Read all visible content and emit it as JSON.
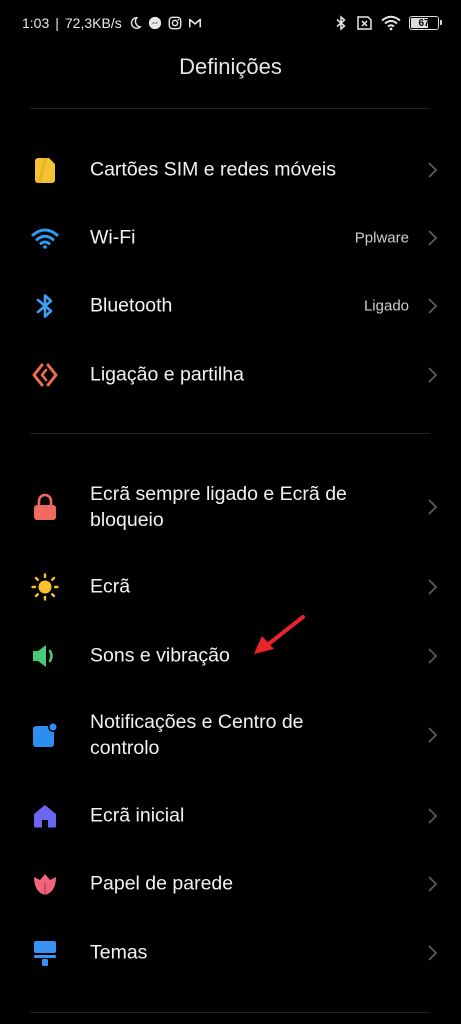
{
  "status_bar": {
    "time": "1:03",
    "separator": "|",
    "speed": "72,3KB/s",
    "battery_level": "67",
    "left_icons": [
      "moon-icon",
      "messenger-icon",
      "instagram-icon",
      "gmail-icon"
    ],
    "right_icons": [
      "bluetooth-icon",
      "no-sim-icon",
      "wifi-icon",
      "battery-icon"
    ]
  },
  "page": {
    "title": "Definições"
  },
  "settings": {
    "sim": {
      "label": "Cartões SIM e redes móveis",
      "icon": "sim-card-icon",
      "color": "#f5c232"
    },
    "wifi": {
      "label": "Wi-Fi",
      "value": "Pplware",
      "icon": "wifi-icon",
      "color": "#2e9cf3"
    },
    "bluetooth": {
      "label": "Bluetooth",
      "value": "Ligado",
      "icon": "bluetooth-icon",
      "color": "#3ea0f5"
    },
    "connection": {
      "label": "Ligação e partilha",
      "icon": "connection-sharing-icon",
      "color": "#f26c4f"
    },
    "lockscreen": {
      "label_line1": "Ecrã sempre ligado e Ecrã de",
      "label_line2": "bloqueio",
      "icon": "lock-icon",
      "color": "#f16a62"
    },
    "display": {
      "label": "Ecrã",
      "icon": "sun-icon",
      "color": "#f7c22a"
    },
    "sound": {
      "label": "Sons e vibração",
      "icon": "speaker-icon",
      "color": "#47c978"
    },
    "notifications": {
      "label_line1": "Notificações e Centro de",
      "label_line2": "controlo",
      "icon": "notification-icon",
      "color": "#2d8ef0"
    },
    "home": {
      "label": "Ecrã inicial",
      "icon": "home-icon",
      "color": "#6a66f1"
    },
    "wallpaper": {
      "label": "Papel de parede",
      "icon": "flower-icon",
      "color": "#f2647c"
    },
    "themes": {
      "label": "Temas",
      "icon": "brush-icon",
      "color": "#3a93f2"
    }
  },
  "annotation": {
    "icon": "red-arrow-icon",
    "color": "#e8232a"
  },
  "colors": {
    "background": "#000000",
    "divider": "#222222",
    "chevron": "#5a5a5a"
  }
}
